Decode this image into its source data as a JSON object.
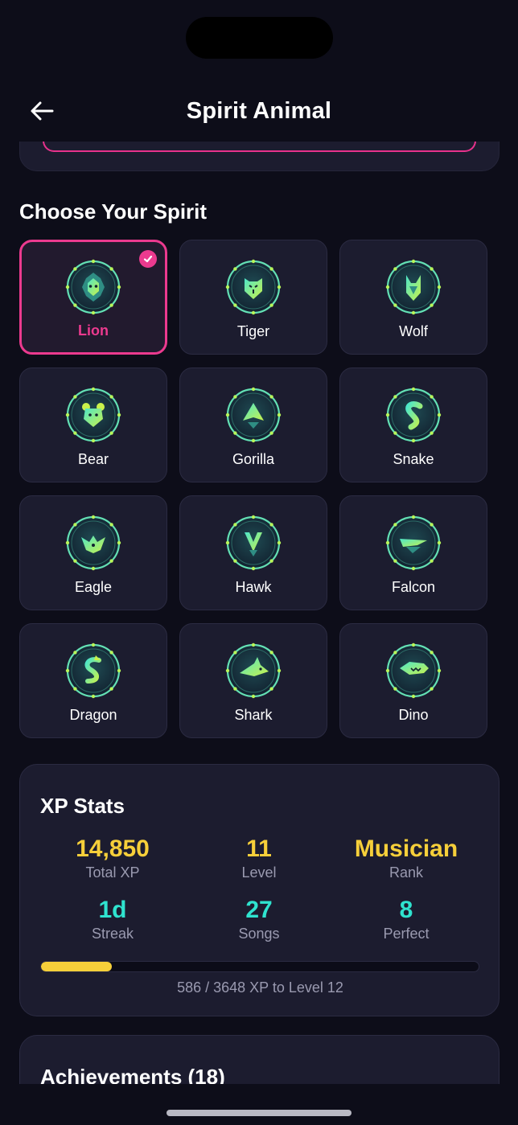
{
  "header": {
    "title": "Spirit Animal"
  },
  "section": {
    "title": "Choose Your Spirit"
  },
  "colors": {
    "accent": "#ec3a8f",
    "gold": "#f6cf3a",
    "teal": "#2fe3cf",
    "card": "#1c1c2f"
  },
  "spirits": [
    {
      "label": "Lion",
      "icon": "lion-icon",
      "selected": true
    },
    {
      "label": "Tiger",
      "icon": "tiger-icon",
      "selected": false
    },
    {
      "label": "Wolf",
      "icon": "wolf-icon",
      "selected": false
    },
    {
      "label": "Bear",
      "icon": "bear-icon",
      "selected": false
    },
    {
      "label": "Gorilla",
      "icon": "gorilla-icon",
      "selected": false
    },
    {
      "label": "Snake",
      "icon": "snake-icon",
      "selected": false
    },
    {
      "label": "Eagle",
      "icon": "eagle-icon",
      "selected": false
    },
    {
      "label": "Hawk",
      "icon": "hawk-icon",
      "selected": false
    },
    {
      "label": "Falcon",
      "icon": "falcon-icon",
      "selected": false
    },
    {
      "label": "Dragon",
      "icon": "dragon-icon",
      "selected": false
    },
    {
      "label": "Shark",
      "icon": "shark-icon",
      "selected": false
    },
    {
      "label": "Dino",
      "icon": "dino-icon",
      "selected": false
    }
  ],
  "xp": {
    "title": "XP Stats",
    "stats": [
      {
        "value": "14,850",
        "label": "Total XP"
      },
      {
        "value": "11",
        "label": "Level"
      },
      {
        "value": "Musician",
        "label": "Rank"
      },
      {
        "value": "1d",
        "label": "Streak"
      },
      {
        "value": "27",
        "label": "Songs"
      },
      {
        "value": "8",
        "label": "Perfect"
      }
    ],
    "progress_fraction": 0.161,
    "progress_text": "586 / 3648 XP to Level 12"
  },
  "achievements": {
    "title": "Achievements (18)"
  }
}
